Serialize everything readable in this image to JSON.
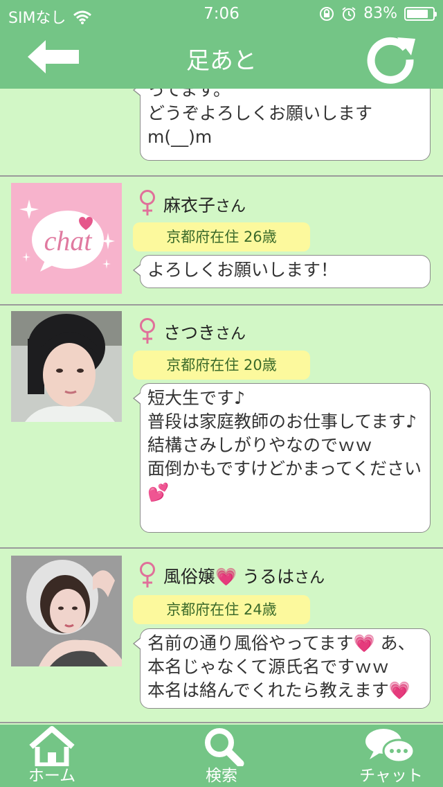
{
  "status": {
    "carrier": "SIMなし",
    "time": "7:06",
    "battery": "83%",
    "battery_level": 0.83
  },
  "header": {
    "title": "足あと"
  },
  "partial_message": "ってます。\nどうぞよろしくお願いします\nm(__)m",
  "entries": [
    {
      "name": "麻衣子",
      "suffix": "さん",
      "location": "京都府在住 26歳",
      "message": "よろしくお願いします！",
      "avatar_text": "chat"
    },
    {
      "name": "さつき",
      "suffix": "さん",
      "location": "京都府在住 20歳",
      "message": "短大生です♪\n普段は家庭教師のお仕事してます♪\n結構さみしがりやなのでｗｗ\n面倒かもですけどかまってください💕"
    },
    {
      "name": "風俗嬢💗 うるは",
      "suffix": "さん",
      "location": "京都府在住 24歳",
      "message": "名前の通り風俗やってます💗 あ、本名じゃなくて源氏名ですｗｗ\n本名は絡んでくれたら教えます💗"
    }
  ],
  "tabs": [
    {
      "label": "ホーム",
      "icon": "home-icon"
    },
    {
      "label": "検索",
      "icon": "search-icon"
    },
    {
      "label": "チャット",
      "icon": "chat-icon"
    }
  ],
  "colors": {
    "header": "#74c586",
    "background": "#d2f7c6",
    "badge": "#fcf99d",
    "female": "#e0709a"
  }
}
